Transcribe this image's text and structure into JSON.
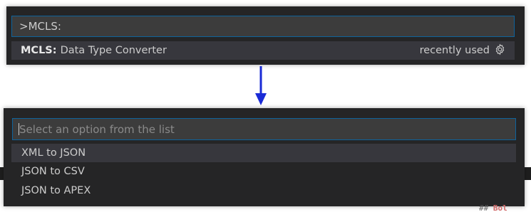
{
  "top_palette": {
    "input_value": ">MCLS:",
    "result": {
      "prefix": "MCLS:",
      "label": "Data Type Converter",
      "meta": "recently used"
    }
  },
  "bottom_palette": {
    "placeholder": "Select an option from the list",
    "options": [
      "XML to JSON",
      "JSON to CSV",
      "JSON to APEX"
    ]
  },
  "peek_text": {
    "hash": "##",
    "red": "Bol"
  },
  "colors": {
    "panel": "#252526",
    "input": "#3c3c3c",
    "focus_border": "#0e639c",
    "arrow": "#1a2bd6"
  },
  "icons": {
    "settings": "gear-icon",
    "arrow": "arrow-down-icon"
  }
}
